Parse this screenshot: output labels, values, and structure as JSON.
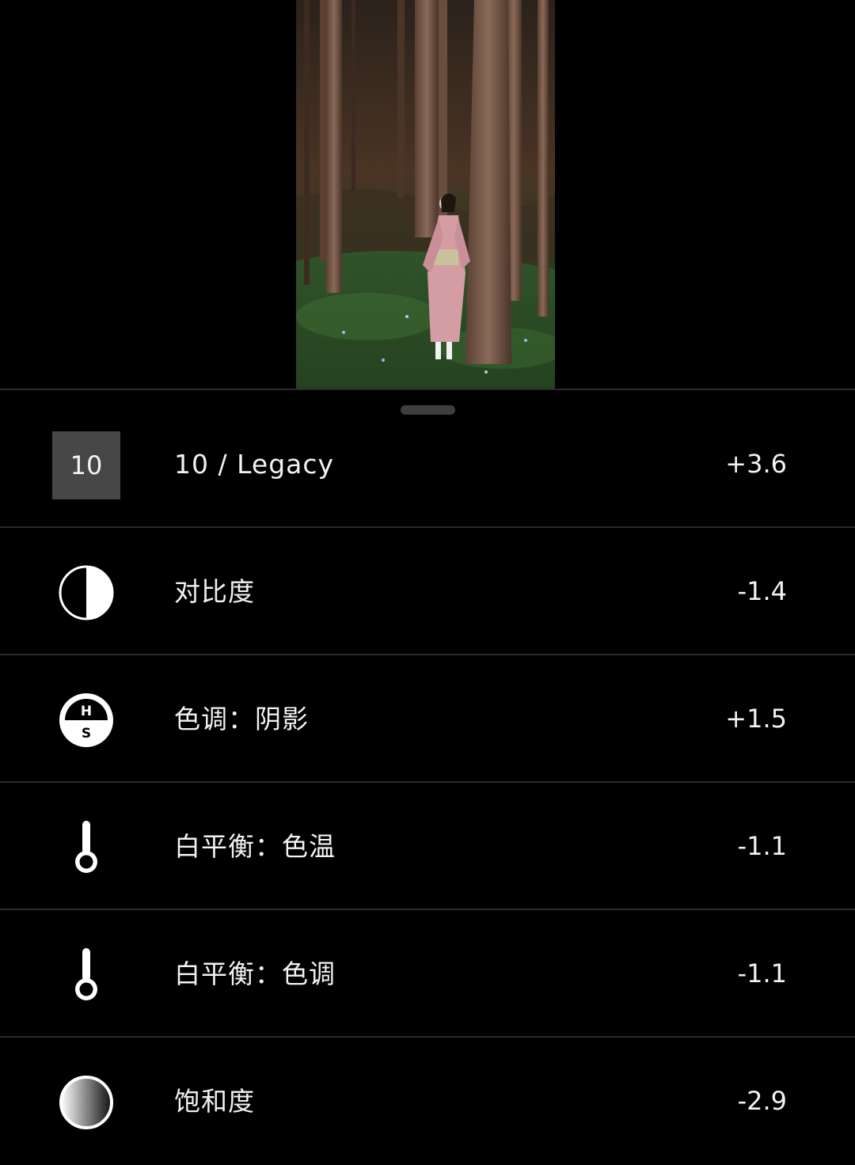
{
  "edits": [
    {
      "id": "preset",
      "icon": "preset-badge",
      "badge": "10",
      "label": "10 / Legacy",
      "value": "+3.6"
    },
    {
      "id": "contrast",
      "icon": "contrast-icon",
      "label": "对比度",
      "value": "-1.4"
    },
    {
      "id": "tone-shadows",
      "icon": "hs-tone-icon",
      "label": "色调：阴影",
      "value": "+1.5"
    },
    {
      "id": "wb-temperature",
      "icon": "thermometer-icon",
      "label": "白平衡：色温",
      "value": "-1.1"
    },
    {
      "id": "wb-tint",
      "icon": "thermometer-icon",
      "label": "白平衡：色调",
      "value": "-1.1"
    },
    {
      "id": "saturation",
      "icon": "saturation-icon",
      "label": "饱和度",
      "value": "-2.9"
    }
  ],
  "icon_letters": {
    "hue": "H",
    "saturation": "S"
  },
  "colors": {
    "background": "#000000",
    "badge": "#474747",
    "divider": "#2b2b2b",
    "text": "#f2f2f2"
  }
}
